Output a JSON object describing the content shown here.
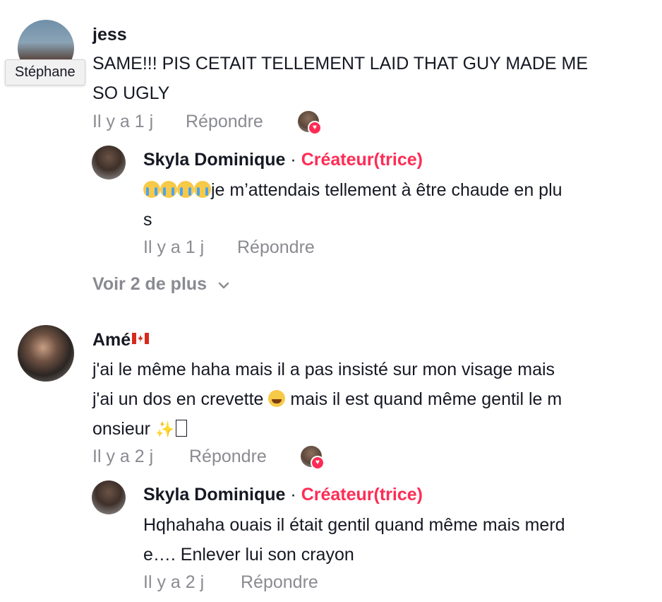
{
  "comments": [
    {
      "username": "jess",
      "text_lines": [
        "SAME!!! PIS CETAIT TELLEMENT LAID THAT GUY MADE ME",
        "SO UGLY"
      ],
      "time": "Il y a 1 j",
      "reply_label": "Répondre",
      "tooltip": "Stéphane",
      "reply": {
        "username": "Skyla Dominique",
        "separator": "·",
        "creator_label": "Créateur(trice)",
        "text_line1": "je m’attendais tellement à être chaude en plu",
        "text_line2": "s",
        "time": "Il y a 1 j",
        "reply_label": "Répondre"
      },
      "more_label": "Voir 2 de plus"
    },
    {
      "username": "Amé",
      "text_line1": "j'ai le même haha mais il a pas insisté sur mon visage mais",
      "text_line2a": "j'ai un dos en crevette ",
      "text_line2b": " mais il est quand même gentil le m",
      "text_line3": "onsieur ",
      "time": "Il y a 2 j",
      "reply_label": "Répondre",
      "reply": {
        "username": "Skyla Dominique",
        "separator": "·",
        "creator_label": "Créateur(trice)",
        "text_lines": [
          "Hqhahaha ouais il était gentil quand même mais merd",
          "e…. Enlever lui son crayon"
        ],
        "time": "Il y a 2 j",
        "reply_label": "Répondre"
      }
    }
  ],
  "icons": {
    "heart": "heart-icon",
    "chevron": "chevron-down-icon",
    "flag": "canada-flag-icon",
    "crying": "loudly-crying-face-icon",
    "laughing": "tears-of-joy-icon",
    "sparkles": "sparkles-icon"
  },
  "colors": {
    "creator": "#fe2c55",
    "meta": "#8a8b91",
    "text": "#161823"
  }
}
